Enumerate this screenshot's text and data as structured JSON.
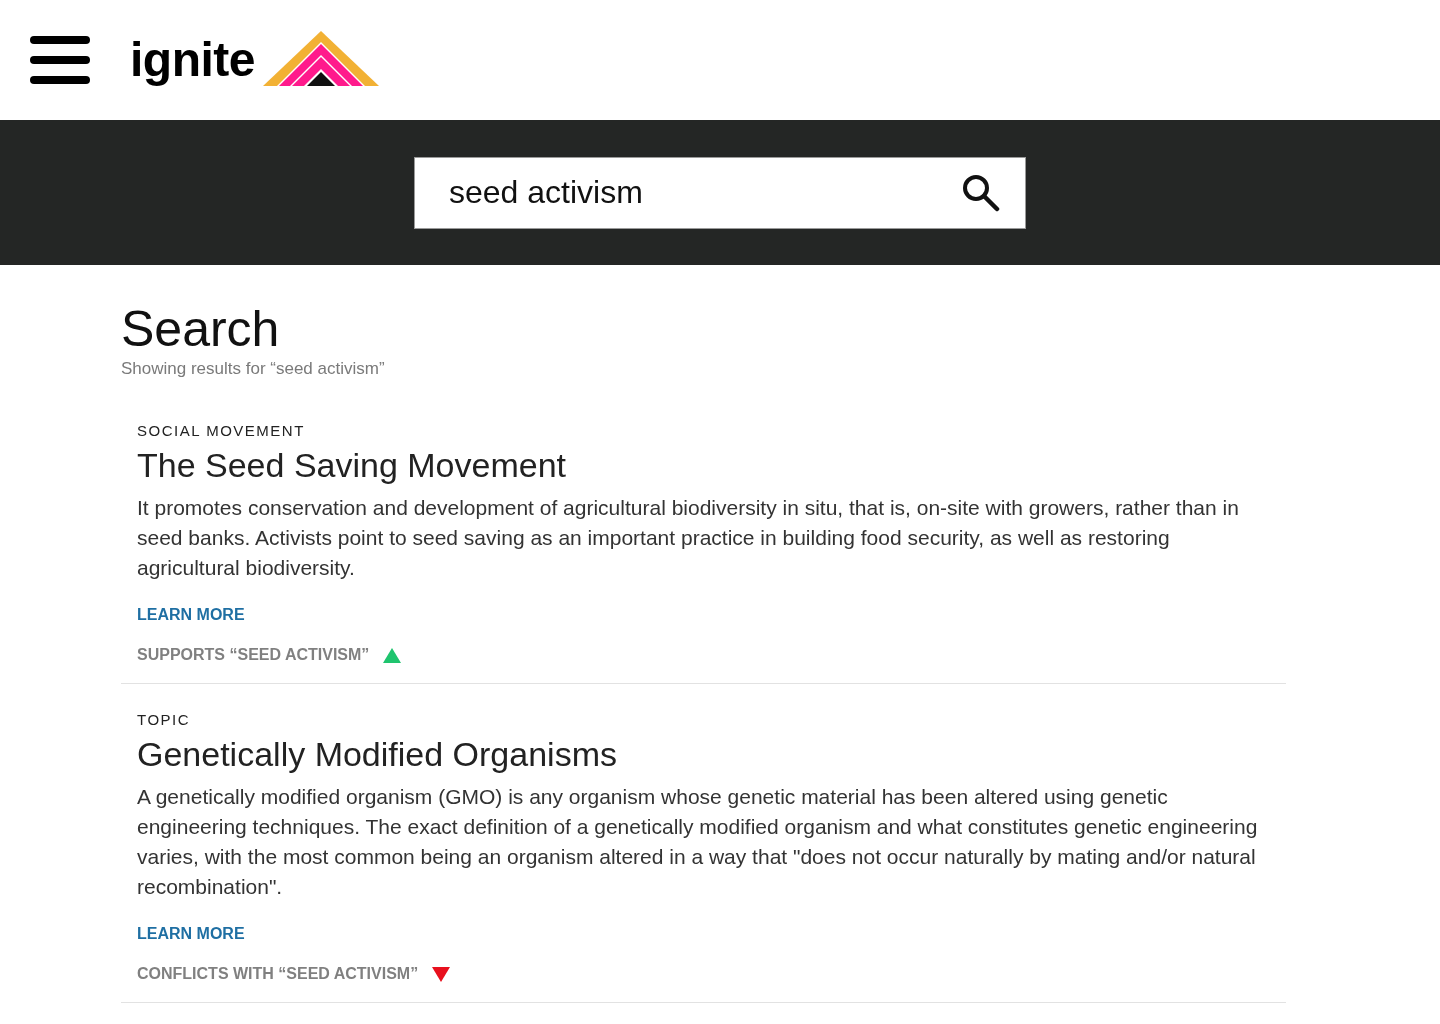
{
  "header": {
    "logo_text": "ignite"
  },
  "search": {
    "value": "seed activism"
  },
  "page": {
    "title": "Search",
    "subtitle": "Showing results for “seed activism”"
  },
  "results": [
    {
      "category": "SOCIAL MOVEMENT",
      "title": "The Seed Saving Movement",
      "description": "It promotes conservation and development of agricultural biodiversity in situ, that is, on-site with growers, rather than in seed banks. Activists point to seed saving as an important practice in building food security, as well as restoring agricultural biodiversity.",
      "link": "LEARN MORE",
      "stance": {
        "kind": "supports",
        "label": "SUPPORTS “SEED ACTIVISM”"
      }
    },
    {
      "category": "TOPIC",
      "title": "Genetically Modified Organisms",
      "description": "A genetically modified organism (GMO) is any organism whose genetic material has been altered using genetic engineering techniques. The exact definition of a genetically modified organism and what constitutes genetic engineering varies, with the most common being an organism altered in a way that \"does not occur naturally by mating and/or natural recombination\".",
      "link": "LEARN MORE",
      "stance": {
        "kind": "conflicts",
        "label": "CONFLICTS WITH “SEED ACTIVISM”"
      }
    }
  ]
}
